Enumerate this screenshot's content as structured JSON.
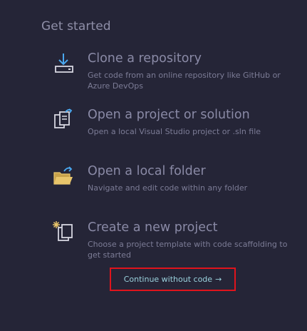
{
  "header": {
    "title": "Get started"
  },
  "items": [
    {
      "title": "Clone a repository",
      "description": "Get code from an online repository like GitHub or Azure DevOps",
      "icon": "download-icon"
    },
    {
      "title": "Open a project or solution",
      "description": "Open a local Visual Studio project or .sln file",
      "icon": "open-project-icon"
    },
    {
      "title": "Open a local folder",
      "description": "Navigate and edit code within any folder",
      "icon": "open-folder-icon"
    },
    {
      "title": "Create a new project",
      "description": "Choose a project template with code scaffolding to get started",
      "icon": "new-project-icon"
    }
  ],
  "continue": {
    "label": "Continue without code",
    "arrow": "→"
  },
  "colors": {
    "background": "#252537",
    "text": "#8a8aa6",
    "link": "#9ad1dc",
    "highlight_border": "#e0141c",
    "icon_blue": "#4aa8f0",
    "icon_folder": "#e8c56b"
  }
}
